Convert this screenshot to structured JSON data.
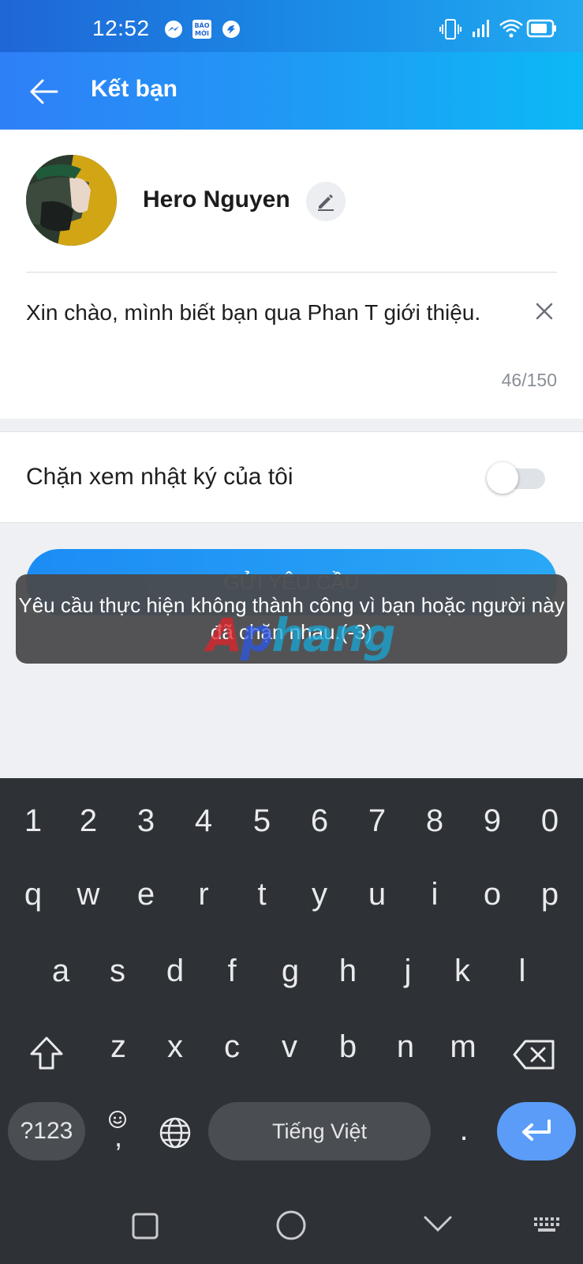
{
  "status_bar": {
    "time": "12:52",
    "icons": [
      "messenger-icon",
      "baomoi-icon",
      "messaging-icon",
      "vibrate-icon",
      "signal-icon",
      "wifi-icon",
      "battery-icon"
    ],
    "baomoi_text": "BÁO MỚI"
  },
  "header": {
    "title": "Kết bạn",
    "back_icon": "arrow-left-icon",
    "background_colors": [
      "#2f7ff7",
      "#0cb9f5"
    ]
  },
  "profile": {
    "name": "Hero Nguyen",
    "edit_icon": "pencil-icon"
  },
  "message": {
    "value": "Xin chào, mình biết bạn qua Phan T giới thiệu.",
    "counter": "46/150",
    "clear_icon": "close-icon"
  },
  "privacy": {
    "label": "Chặn xem nhật ký của tôi",
    "toggle_on": false
  },
  "send_button": {
    "label": "GỬI YÊU CẦU"
  },
  "toast": {
    "text": "Yêu cầu thực hiện không thành công vì bạn hoặc người này đã chặn nhau.(-3)"
  },
  "watermark": {
    "text": "Aphang",
    "parts": [
      "A",
      "p",
      "hang"
    ]
  },
  "keyboard": {
    "row_numbers": [
      "1",
      "2",
      "3",
      "4",
      "5",
      "6",
      "7",
      "8",
      "9",
      "0"
    ],
    "row_1": [
      "q",
      "w",
      "e",
      "r",
      "t",
      "y",
      "u",
      "i",
      "o",
      "p"
    ],
    "row_2": [
      "a",
      "s",
      "d",
      "f",
      "g",
      "h",
      "j",
      "k",
      "l"
    ],
    "row_3": [
      "z",
      "x",
      "c",
      "v",
      "b",
      "n",
      "m"
    ],
    "symbols_key": "?123",
    "comma_key": ",",
    "space_label": "Tiếng Việt",
    "period_key": ".",
    "icons": [
      "shift-icon",
      "backspace-icon",
      "emoji-icon",
      "globe-icon",
      "enter-icon"
    ]
  },
  "nav_bar": {
    "icons": [
      "recents-square-icon",
      "home-circle-icon",
      "back-chevron-icon",
      "keyboard-switch-icon"
    ]
  }
}
